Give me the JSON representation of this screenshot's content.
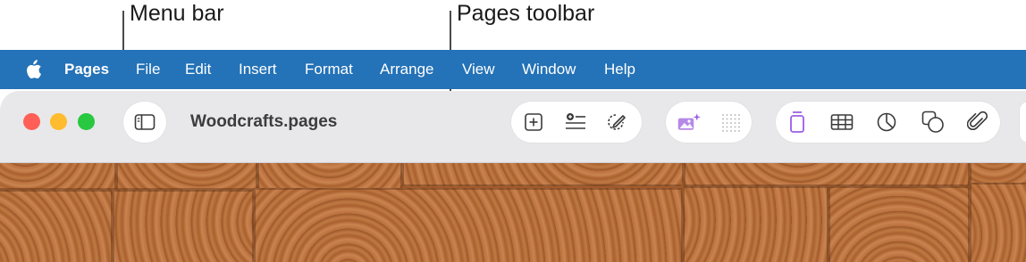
{
  "callouts": {
    "menu_bar_label": "Menu bar",
    "pages_toolbar_label": "Pages toolbar"
  },
  "menubar": {
    "background": "#2472b7",
    "apple_icon": "apple-logo-icon",
    "app_name": "Pages",
    "items": [
      "File",
      "Edit",
      "Insert",
      "Format",
      "Arrange",
      "View",
      "Window",
      "Help"
    ]
  },
  "window": {
    "traffic_lights": {
      "close": "#ff5f57",
      "minimize": "#febc2e",
      "zoom": "#28c840"
    },
    "document_title": "Woodcrafts.pages",
    "toolbar": {
      "sidebar_icon": "sidebar-toggle-icon",
      "group1": [
        "add-page-icon",
        "add-section-icon",
        "annotate-icon"
      ],
      "group2": [
        "image-playground-icon",
        "grid-icon"
      ],
      "group3": [
        "text-icon",
        "table-icon",
        "chart-icon",
        "shape-icon",
        "media-icon"
      ],
      "accent": "#9b5de5"
    }
  }
}
